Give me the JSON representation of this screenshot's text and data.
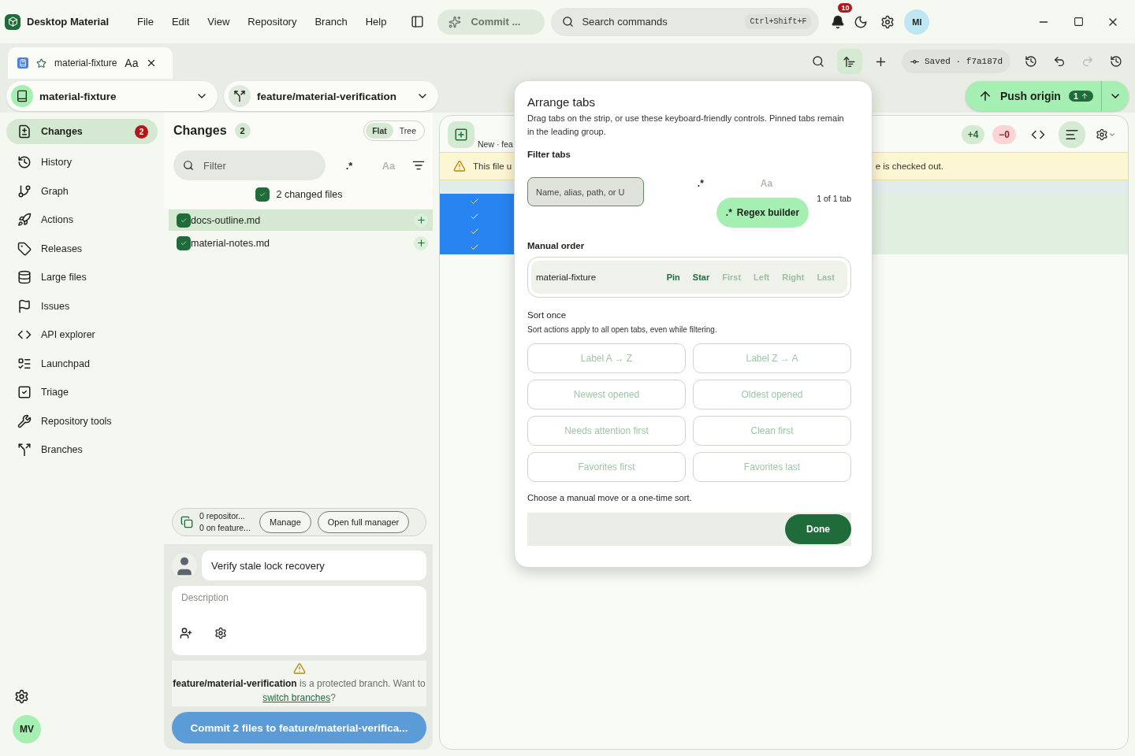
{
  "app": {
    "title": "Desktop Material",
    "menu": [
      "File",
      "Edit",
      "View",
      "Repository",
      "Branch",
      "Help"
    ],
    "commit_button": "Commit ...",
    "search": {
      "placeholder": "Search commands",
      "shortcut": "Ctrl+Shift+F"
    },
    "notifications": "10",
    "avatar": "MI"
  },
  "tab_strip": {
    "tabs": [
      {
        "label": "material-fixture",
        "case_toggle": "Aa",
        "selected": true,
        "starred": false
      }
    ],
    "sort_active": true,
    "saved": "Saved · f7a187d",
    "redo_disabled": true
  },
  "repository": {
    "name": "material-fixture"
  },
  "branch": {
    "name": "feature/material-verification"
  },
  "push": {
    "label": "Push origin",
    "count": "1"
  },
  "sidebar": {
    "items": [
      {
        "label": "Changes",
        "badge": "2",
        "selected": true
      },
      {
        "label": "History",
        "selected": false
      },
      {
        "label": "Graph",
        "selected": false
      },
      {
        "label": "Actions",
        "selected": false
      },
      {
        "label": "Releases",
        "selected": false
      },
      {
        "label": "Large files",
        "selected": false
      },
      {
        "label": "Issues",
        "selected": false
      },
      {
        "label": "API explorer",
        "selected": false
      },
      {
        "label": "Launchpad",
        "selected": false
      },
      {
        "label": "Triage",
        "selected": false
      },
      {
        "label": "Repository tools",
        "selected": false
      },
      {
        "label": "Branches",
        "selected": false
      }
    ],
    "user": "MV"
  },
  "changes": {
    "title": "Changes",
    "count": "2",
    "views": [
      {
        "label": "Flat",
        "selected": true
      },
      {
        "label": "Tree",
        "selected": false
      }
    ],
    "filter": {
      "placeholder": "Filter",
      "regex": ".*",
      "regex_on": true,
      "case": "Aa",
      "case_on": false
    },
    "summary": "2 changed files",
    "all_checked": true,
    "files": [
      {
        "name": "docs-outline.md",
        "checked": true,
        "selected": true
      },
      {
        "name": "material-notes.md",
        "checked": true,
        "selected": false
      }
    ],
    "stash": {
      "line1": "0 repositor...",
      "line2": "0 on feature...",
      "buttons": [
        "Manage",
        "Open full manager"
      ]
    },
    "commit": {
      "summary": "Verify stale lock recovery",
      "description_placeholder": "Description",
      "notice": "**feature/material-verification** is a protected branch. Want to",
      "notice_link": "switch branches",
      "notice_end": "?",
      "button": "Commit 2 files to feature/material-verifica..."
    }
  },
  "diff": {
    "title": "New · fea",
    "added": "+4",
    "removed": "−0",
    "lines_view_active": true,
    "warning_start": "This file u",
    "warning_end": "e is checked out.",
    "lines": [
      {
        "selected": true
      },
      {
        "selected": true
      },
      {
        "selected": true
      },
      {
        "selected": true
      }
    ]
  },
  "arrange_tabs": {
    "title": "Arrange tabs",
    "description": "Drag tabs on the strip, or use these keyboard-friendly controls. Pinned tabs remain in the leading group.",
    "filter_label": "Filter tabs",
    "filter_placeholder": "Name, alias, path, or U",
    "regex": ".*",
    "regex_on": true,
    "case": "Aa",
    "case_on": false,
    "count": "1 of 1 tab",
    "regex_builder": "Regex builder",
    "regex_builder_icon": ".*",
    "manual_label": "Manual order",
    "manual_tab": "material-fixture",
    "manual_actions": [
      {
        "label": "Pin",
        "disabled": false
      },
      {
        "label": "Star",
        "disabled": false
      },
      {
        "label": "First",
        "disabled": true
      },
      {
        "label": "Left",
        "disabled": true
      },
      {
        "label": "Right",
        "disabled": true
      },
      {
        "label": "Last",
        "disabled": true
      }
    ],
    "sort_label": "Sort once",
    "sort_note": "Sort actions apply to all open tabs, even while filtering.",
    "sort_actions": [
      {
        "label": "Label A → Z",
        "disabled": true
      },
      {
        "label": "Label Z → A",
        "disabled": true
      },
      {
        "label": "Newest opened",
        "disabled": true
      },
      {
        "label": "Oldest opened",
        "disabled": true
      },
      {
        "label": "Needs attention first",
        "disabled": true
      },
      {
        "label": "Clean first",
        "disabled": true
      },
      {
        "label": "Favorites first",
        "disabled": true
      },
      {
        "label": "Favorites last",
        "disabled": true
      }
    ],
    "footer": "Choose a manual move or a one-time sort.",
    "done": "Done"
  }
}
